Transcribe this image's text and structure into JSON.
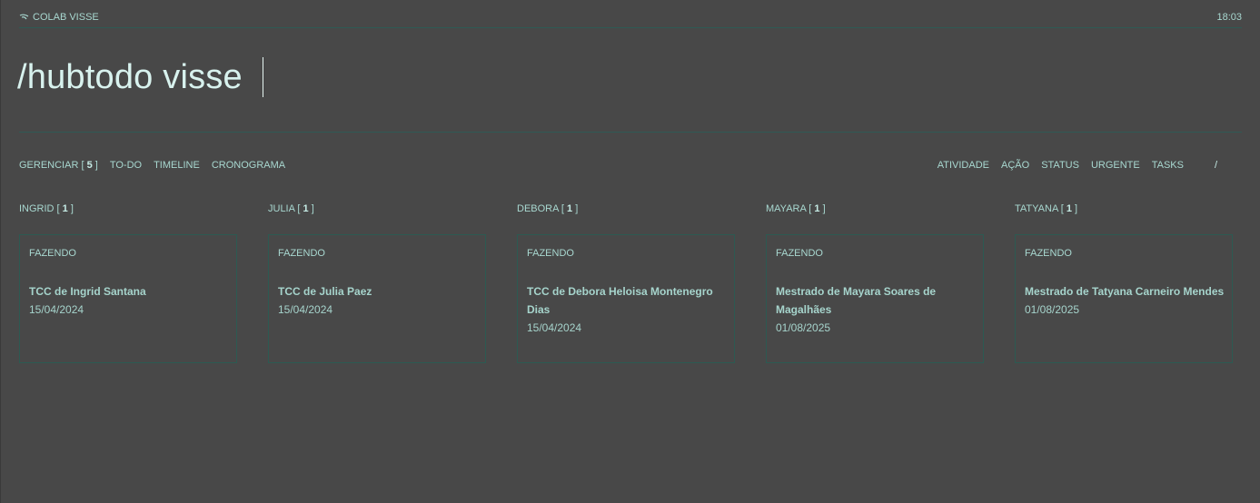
{
  "header": {
    "brand": "COLAB VISSE",
    "brand_icon": "lab-logo-icon",
    "time": "18:03"
  },
  "page": {
    "title": "/hubtodo visse"
  },
  "nav_left": [
    {
      "label": "GERENCIAR [ ",
      "count": "5",
      "suffix": " ]"
    },
    {
      "label": "TO-DO"
    },
    {
      "label": "TIMELINE"
    },
    {
      "label": "CRONOGRAMA"
    }
  ],
  "nav_right": [
    "ATIVIDADE",
    "AÇÃO",
    "STATUS",
    "URGENTE",
    "TASKS"
  ],
  "nav_slash": "/",
  "columns": [
    {
      "name": "INGRID",
      "count": "1",
      "card": {
        "status": "FAZENDO",
        "title": "TCC de Ingrid Santana",
        "date": "15/04/2024"
      }
    },
    {
      "name": "JULIA",
      "count": "1",
      "card": {
        "status": "FAZENDO",
        "title": "TCC de Julia Paez",
        "date": "15/04/2024"
      }
    },
    {
      "name": "DEBORA",
      "count": "1",
      "card": {
        "status": "FAZENDO",
        "title": "TCC de Debora Heloisa Montenegro Dias",
        "date": "15/04/2024"
      }
    },
    {
      "name": "MAYARA",
      "count": "1",
      "card": {
        "status": "FAZENDO",
        "title": "Mestrado de Mayara Soares de Magalhães",
        "date": "01/08/2025"
      }
    },
    {
      "name": "TATYANA",
      "count": "1",
      "card": {
        "status": "FAZENDO",
        "title": "Mestrado de Tatyana Carneiro Mendes",
        "date": "01/08/2025"
      }
    }
  ]
}
